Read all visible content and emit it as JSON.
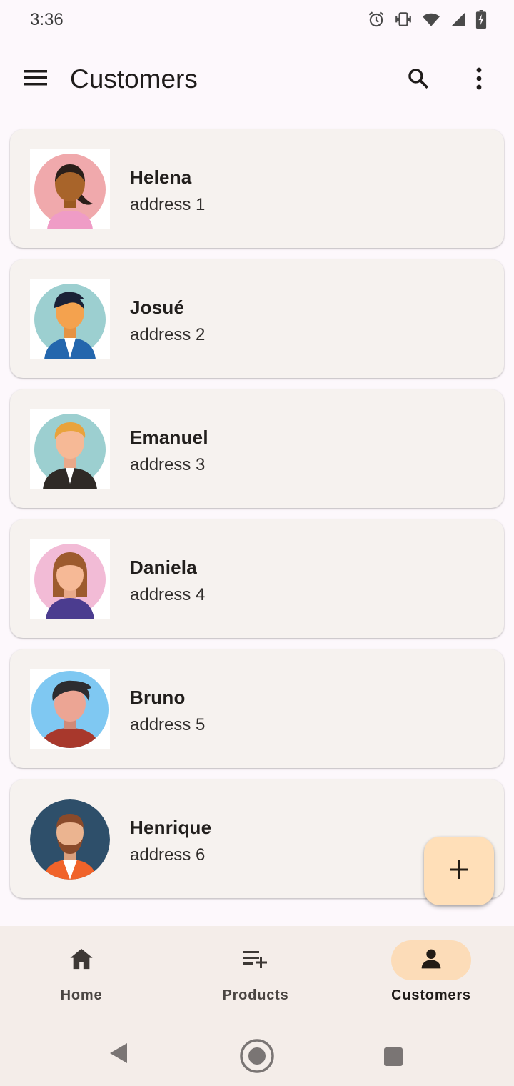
{
  "status": {
    "time": "3:36",
    "icons": [
      "alarm-icon",
      "vibrate-icon",
      "wifi-icon",
      "signal-icon",
      "battery-charging-icon"
    ]
  },
  "appbar": {
    "title": "Customers",
    "menu_icon": "menu-icon",
    "search_icon": "search-icon",
    "more_icon": "more-vert-icon"
  },
  "customers": [
    {
      "name": "Helena",
      "address": "address 1"
    },
    {
      "name": "Josué",
      "address": "address 2"
    },
    {
      "name": "Emanuel",
      "address": "address 3"
    },
    {
      "name": "Daniela",
      "address": "address 4"
    },
    {
      "name": "Bruno",
      "address": "address 5"
    },
    {
      "name": "Henrique",
      "address": "address 6"
    }
  ],
  "fab": {
    "icon": "add-icon"
  },
  "bottom_nav": {
    "items": [
      {
        "label": "Home",
        "icon": "home-icon",
        "active": false
      },
      {
        "label": "Products",
        "icon": "playlist-add-icon",
        "active": false
      },
      {
        "label": "Customers",
        "icon": "person-icon",
        "active": true
      }
    ]
  },
  "system_nav": {
    "icons": [
      "back-icon",
      "home-circle-icon",
      "recents-icon"
    ]
  },
  "colors": {
    "background": "#fdf8fc",
    "card": "#f6f2ef",
    "fab": "#ffdfb8",
    "nav_active_pill": "#fcdcb8",
    "nav_bar": "#f4ede9"
  }
}
